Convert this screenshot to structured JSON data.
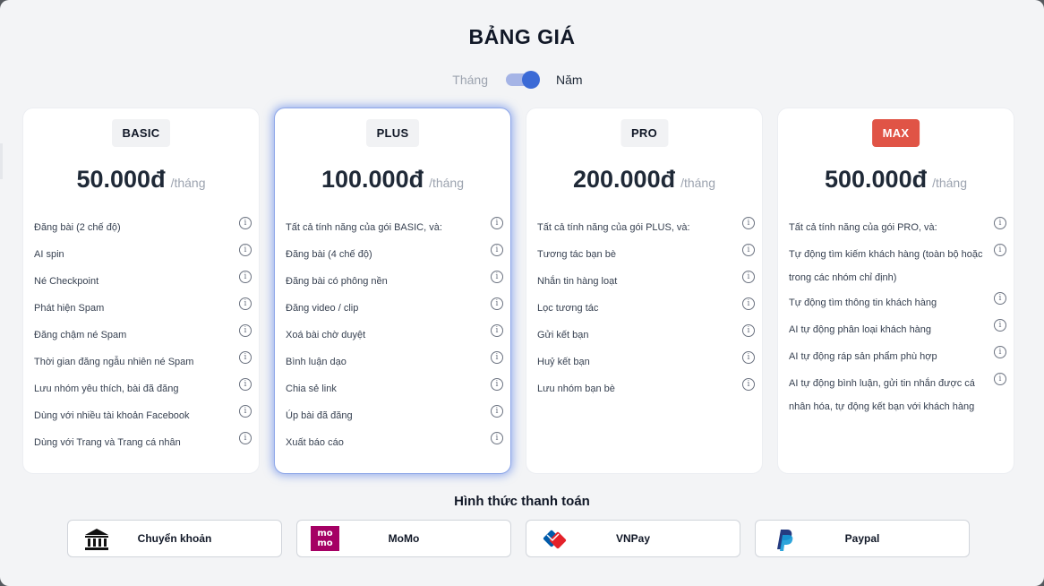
{
  "title": "BẢNG GIÁ",
  "toggle": {
    "month_label": "Tháng",
    "year_label": "Năm",
    "selected": "Năm"
  },
  "plans": [
    {
      "name": "BASIC",
      "price": "50.000đ",
      "period": "/tháng",
      "features": [
        "Đăng bài (2 chế độ)",
        "AI spin",
        "Né Checkpoint",
        "Phát hiện Spam",
        "Đăng chậm né Spam",
        "Thời gian đăng ngẫu nhiên né Spam",
        "Lưu nhóm yêu thích, bài đã đăng",
        "Dùng với nhiều tài khoản Facebook",
        "Dùng với Trang và Trang cá nhân"
      ]
    },
    {
      "name": "PLUS",
      "price": "100.000đ",
      "period": "/tháng",
      "features": [
        "Tất cả tính năng của gói BASIC, và:",
        "Đăng bài (4 chế độ)",
        "Đăng bài có phông nền",
        "Đăng video / clip",
        "Xoá bài chờ duyệt",
        "Bình luận dạo",
        "Chia sẻ link",
        "Úp bài đã đăng",
        "Xuất báo cáo"
      ]
    },
    {
      "name": "PRO",
      "price": "200.000đ",
      "period": "/tháng",
      "features": [
        "Tất cả tính năng của gói PLUS, và:",
        "Tương tác bạn bè",
        "Nhắn tin hàng loạt",
        "Lọc tương tác",
        "Gửi kết bạn",
        "Huỷ kết bạn",
        "Lưu nhóm bạn bè"
      ]
    },
    {
      "name": "MAX",
      "price": "500.000đ",
      "period": "/tháng",
      "features": [
        "Tất cả tính năng của gói PRO, và:",
        "Tự động tìm kiếm khách hàng (toàn bộ hoặc trong các nhóm chỉ định)",
        "Tự động tìm thông tin khách hàng",
        "AI tự động phân loại khách hàng",
        "AI tự động ráp sản phẩm phù hợp",
        "AI tự động bình luận, gửi tin nhắn được cá nhân hóa, tự động kết bạn với khách hàng"
      ]
    }
  ],
  "payment": {
    "title": "Hình thức thanh toán",
    "methods": [
      {
        "label": "Chuyển khoản",
        "icon": "bank-icon"
      },
      {
        "label": "MoMo",
        "icon": "momo-icon",
        "logo_text": "mo mo"
      },
      {
        "label": "VNPay",
        "icon": "vnpay-icon"
      },
      {
        "label": "Paypal",
        "icon": "paypal-icon"
      }
    ]
  },
  "colors": {
    "accent": "#3b6ad6",
    "max_badge": "#e05446",
    "momo": "#a50064",
    "vnpay_red": "#e4222a",
    "vnpay_blue": "#005baa",
    "paypal_dark": "#253b80",
    "paypal_light": "#179bd7"
  }
}
